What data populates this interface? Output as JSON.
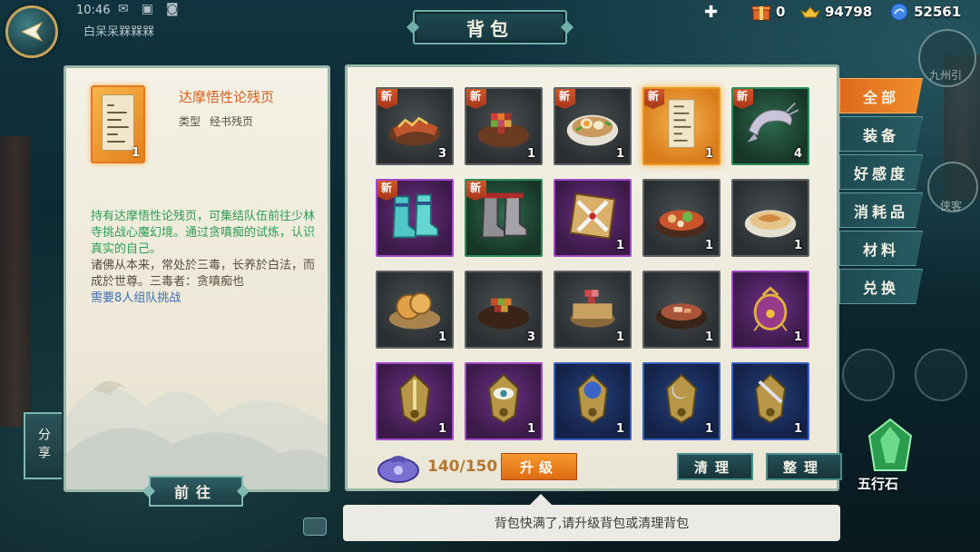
{
  "status_bar": {
    "time": "10:46",
    "player_name": "白呆呆槑槑槑"
  },
  "title": "背包",
  "currencies": [
    {
      "name": "gift-icon",
      "value": "0"
    },
    {
      "name": "gold-ingot-icon",
      "value": "94798"
    },
    {
      "name": "blue-orb-icon",
      "value": "52561"
    }
  ],
  "detail": {
    "item_name": "达摩悟性论残页",
    "item_count": "1",
    "type_label": "类型",
    "type_value": "经书残页",
    "desc_green": "持有达摩悟性论残页，可集结队伍前往少林寺挑战心魔幻境。通过贪嗔痴的试炼，认识真实的自己。",
    "desc_dark": "诸佛从本来，常处於三毒，长养於白法，而成於世尊。三毒者：贪嗔痴也",
    "desc_blue": "需要8人组队挑战",
    "go_button": "前往",
    "share_button": "分享"
  },
  "bag": {
    "new_tag": "新",
    "items": [
      {
        "icon": "roast-meat-icon",
        "rarity": "grey",
        "count": "3",
        "new": true
      },
      {
        "icon": "mosaic-dish-icon",
        "rarity": "grey",
        "count": "1",
        "new": true
      },
      {
        "icon": "egg-noodle-bowl-icon",
        "rarity": "grey",
        "count": "1",
        "new": true
      },
      {
        "icon": "sutra-page-icon",
        "rarity": "gold",
        "count": "1",
        "new": true,
        "selected": true
      },
      {
        "icon": "shrimp-icon",
        "rarity": "green",
        "count": "4",
        "new": true
      },
      {
        "icon": "cyan-boots-icon",
        "rarity": "purple",
        "count": "",
        "new": true
      },
      {
        "icon": "grey-boots-icon",
        "rarity": "green",
        "count": "",
        "new": true
      },
      {
        "icon": "crossed-blades-token-icon",
        "rarity": "purple",
        "count": "1",
        "new": false
      },
      {
        "icon": "hotpot-icon",
        "rarity": "grey",
        "count": "1",
        "new": false
      },
      {
        "icon": "fish-soup-icon",
        "rarity": "grey",
        "count": "1",
        "new": false
      },
      {
        "icon": "pancakes-icon",
        "rarity": "grey",
        "count": "1",
        "new": false
      },
      {
        "icon": "mosaic-pot-icon",
        "rarity": "grey",
        "count": "3",
        "new": false
      },
      {
        "icon": "mosaic-steamer-icon",
        "rarity": "grey",
        "count": "1",
        "new": false
      },
      {
        "icon": "stew-pot-icon",
        "rarity": "grey",
        "count": "1",
        "new": false
      },
      {
        "icon": "purple-pouch-icon",
        "rarity": "purple",
        "count": "1",
        "new": false
      },
      {
        "icon": "sword-emblem-icon",
        "rarity": "purple",
        "count": "1",
        "new": false
      },
      {
        "icon": "eye-emblem-icon",
        "rarity": "purple",
        "count": "1",
        "new": false
      },
      {
        "icon": "orb-emblem-icon",
        "rarity": "blue",
        "count": "1",
        "new": false
      },
      {
        "icon": "moon-emblem-icon",
        "rarity": "blue",
        "count": "1",
        "new": false
      },
      {
        "icon": "blade-emblem-icon",
        "rarity": "blue",
        "count": "1",
        "new": false
      }
    ],
    "capacity": "140/150",
    "upgrade_button": "升级",
    "clean_button": "清理",
    "sort_button": "整理"
  },
  "tabs": [
    "全部",
    "装备",
    "好感度",
    "消耗品",
    "材料",
    "兑换"
  ],
  "side": {
    "five_element_stone": "五行石",
    "jiuzhou_label": "九州引",
    "xiake_label": "侠客"
  },
  "toast": "背包快满了,请升级背包或清理背包",
  "colors": {
    "accent_orange": "#e8781f",
    "panel_border": "#9bb7a9",
    "teal_button": "#1e4b51"
  }
}
